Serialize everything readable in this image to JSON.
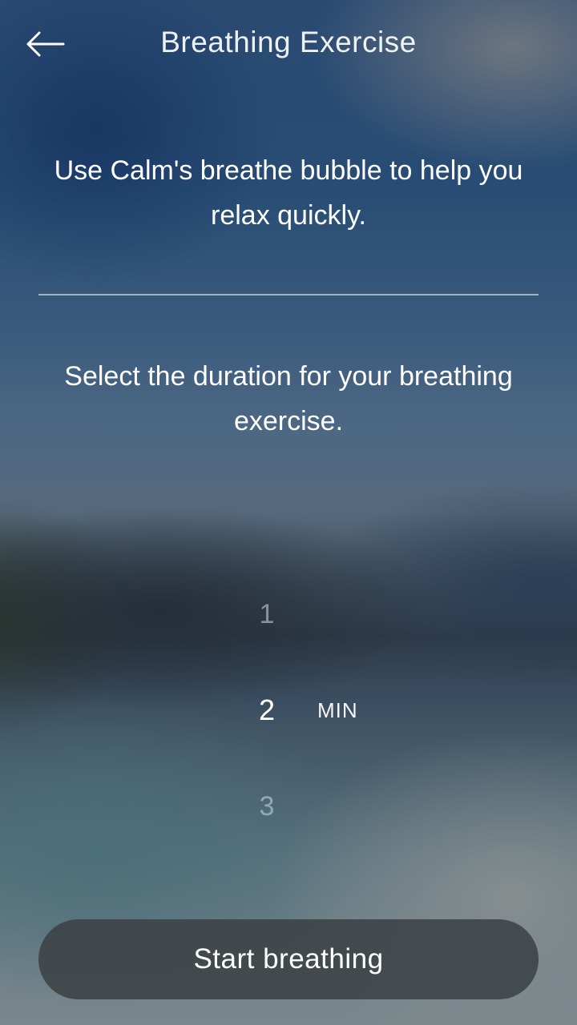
{
  "header": {
    "back_icon": "arrow-left-icon",
    "title": "Breathing Exercise"
  },
  "intro": {
    "text": "Use Calm's breathe bubble to help you relax quickly."
  },
  "duration": {
    "prompt": "Select the duration for your breathing exercise.",
    "options": [
      "1",
      "2",
      "3"
    ],
    "selected": "2",
    "unit": "MIN"
  },
  "actions": {
    "start_label": "Start breathing"
  },
  "colors": {
    "button_bg": "#3c4246",
    "text": "#ffffff"
  }
}
